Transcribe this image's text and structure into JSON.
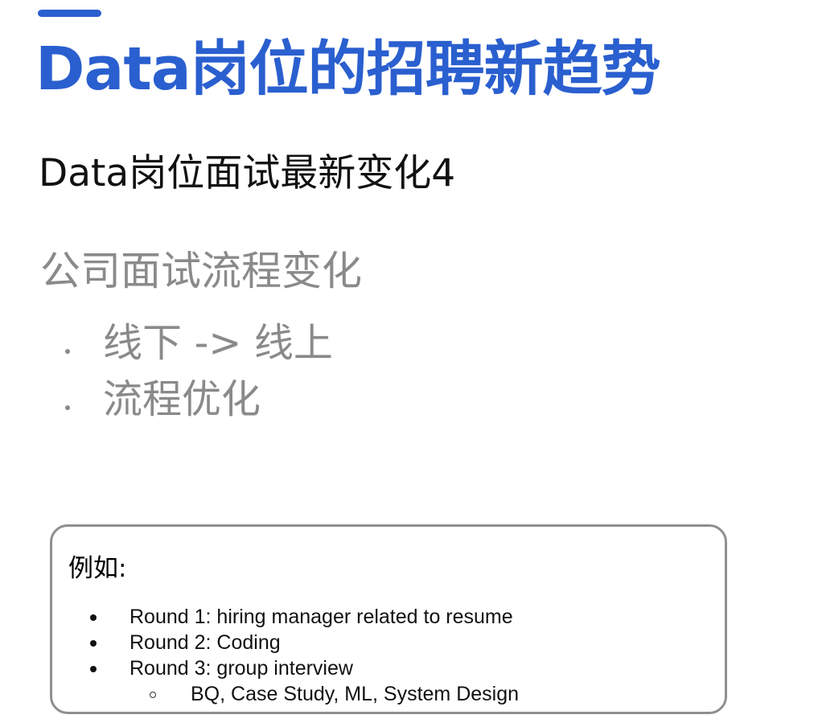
{
  "slide": {
    "title": "Data岗位的招聘新趋势",
    "subtitle": "Data岗位面试最新变化4",
    "section_heading": "公司面试流程变化",
    "bullets": [
      "线下 -> 线上",
      "流程优化"
    ],
    "accent_color": "#2a5fcf"
  },
  "example": {
    "label": "例如:",
    "rounds": [
      "Round 1: hiring manager related to resume",
      "Round 2: Coding",
      "Round 3: group interview"
    ],
    "sub_item": "BQ, Case Study, ML, System Design"
  }
}
